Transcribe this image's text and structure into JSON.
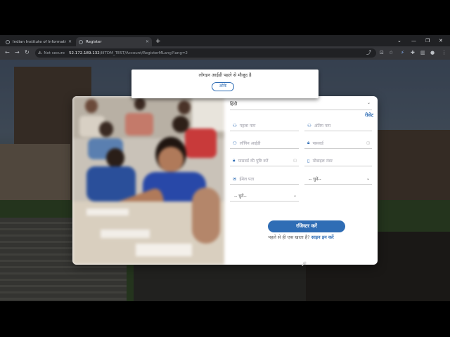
{
  "browser": {
    "tabs": [
      {
        "title": "Indian Institute of Information Te",
        "active": false
      },
      {
        "title": "Register",
        "active": true
      }
    ],
    "new_tab": "+",
    "window_controls": [
      "⌄",
      "—",
      "❐",
      "✕"
    ],
    "security_label": "Not secure",
    "url_host": "52.172.189.132",
    "url_path": "/IIITDM_TEST/Account/RegisterMLang?lang=2"
  },
  "alert": {
    "message": "लॉगइन आईडी पहले से मौजूद है",
    "ok_label": "ओके"
  },
  "form": {
    "language_selected": "हिंदी",
    "reset_label": "रीसेट",
    "fields": {
      "first_name": "पहला नाम",
      "last_name": "अंतिम नाम",
      "login_id": "लॉगिन आईडी",
      "password": "पासवर्ड",
      "confirm_password": "पासवर्ड की पुष्टि करें",
      "mobile": "मोबाइल नंबर",
      "email": "ईमेल पता"
    },
    "select_right": "-- चुनें--",
    "select_left": "-- चुनें--",
    "register_label": "रजिस्टर करें",
    "login_prompt": "पहले से ही एक खाता है?",
    "login_link": "साइन इन करें"
  },
  "colors": {
    "accent": "#2f6db5",
    "chrome_dark": "#202124",
    "chrome_toolbar": "#35363a"
  }
}
